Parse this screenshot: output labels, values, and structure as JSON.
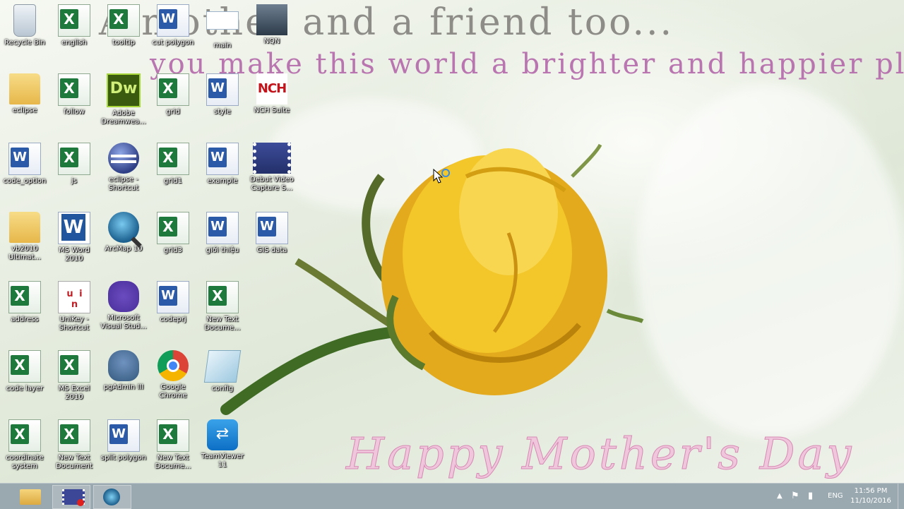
{
  "wallpaper": {
    "line1": "A mother and a friend too...",
    "line2": "you make this world a brighter and happier place !",
    "line3": "Happy Mother's Day"
  },
  "desktop_icons": [
    {
      "label": "Recycle Bin",
      "icon": "recycle-bin-icon"
    },
    {
      "label": "english",
      "icon": "excel-file-icon"
    },
    {
      "label": "tooltip",
      "icon": "excel-file-icon"
    },
    {
      "label": "cut polygon",
      "icon": "word-file-icon"
    },
    {
      "label": "main",
      "icon": "window-icon"
    },
    {
      "label": "NQN",
      "icon": "image-file-icon"
    },
    {
      "label": "eclipse",
      "icon": "folder-icon"
    },
    {
      "label": "follow",
      "icon": "excel-file-icon"
    },
    {
      "label": "Adobe Dreamwea...",
      "icon": "dreamweaver-icon"
    },
    {
      "label": "grid",
      "icon": "excel-file-icon"
    },
    {
      "label": "style",
      "icon": "word-file-icon"
    },
    {
      "label": "NCH Suite",
      "icon": "nch-suite-icon"
    },
    {
      "label": "code_option",
      "icon": "word-file-icon"
    },
    {
      "label": "js",
      "icon": "excel-file-icon"
    },
    {
      "label": "eclipse - Shortcut",
      "icon": "eclipse-icon"
    },
    {
      "label": "grid1",
      "icon": "excel-file-icon"
    },
    {
      "label": "example",
      "icon": "word-file-icon"
    },
    {
      "label": "Debut Video Capture S...",
      "icon": "video-capture-icon"
    },
    {
      "label": "vb2010 Ultimat...",
      "icon": "folder-icon"
    },
    {
      "label": "MS Word 2010",
      "icon": "ms-word-icon"
    },
    {
      "label": "ArcMap 10",
      "icon": "arcmap-icon"
    },
    {
      "label": "grid3",
      "icon": "excel-file-icon"
    },
    {
      "label": "giới thiệu",
      "icon": "word-file-icon"
    },
    {
      "label": "GIS data",
      "icon": "word-file-icon"
    },
    {
      "label": "address",
      "icon": "excel-file-icon"
    },
    {
      "label": "UniKey - Shortcut",
      "icon": "unikey-icon"
    },
    {
      "label": "Microsoft Visual Stud...",
      "icon": "visual-studio-icon"
    },
    {
      "label": "codeprj",
      "icon": "word-file-icon"
    },
    {
      "label": "New Text Docume...",
      "icon": "excel-file-icon"
    },
    {
      "label": "code layer",
      "icon": "excel-file-icon"
    },
    {
      "label": "MS Excel 2010",
      "icon": "excel-file-icon"
    },
    {
      "label": "pgAdmin III",
      "icon": "pgadmin-icon"
    },
    {
      "label": "Google Chrome",
      "icon": "chrome-icon"
    },
    {
      "label": "config",
      "icon": "config-file-icon"
    },
    {
      "label": "coordinate system",
      "icon": "excel-file-icon"
    },
    {
      "label": "New Text Document",
      "icon": "excel-file-icon"
    },
    {
      "label": "split polygon",
      "icon": "word-file-icon"
    },
    {
      "label": "New Text Docume...",
      "icon": "excel-file-icon"
    },
    {
      "label": "TeamViewer 11",
      "icon": "teamviewer-icon"
    }
  ],
  "taskbar": {
    "pinned": [
      {
        "name": "file-explorer",
        "icon": "folder-icon"
      },
      {
        "name": "debut-video-capture",
        "icon": "video-capture-icon"
      },
      {
        "name": "arcmap",
        "icon": "arcmap-icon"
      }
    ],
    "tray": {
      "overflow": "▲",
      "language": "ENG",
      "time": "11:56 PM",
      "date": "11/10/2016"
    }
  }
}
